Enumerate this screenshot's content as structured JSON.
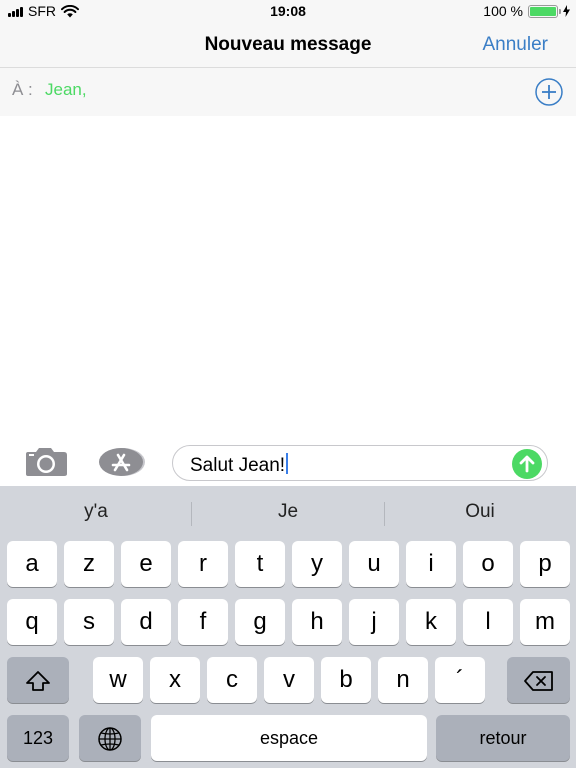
{
  "status_bar": {
    "carrier": "SFR",
    "time": "19:08",
    "battery": "100 %",
    "battery_level": 1.0
  },
  "nav": {
    "title": "Nouveau message",
    "cancel_label": "Annuler"
  },
  "recipients": {
    "label": "À :",
    "value": "Jean,"
  },
  "compose": {
    "message_text": "Salut Jean!"
  },
  "keyboard": {
    "suggestions": [
      "y'a",
      "Je",
      "Oui"
    ],
    "row1": [
      "a",
      "z",
      "e",
      "r",
      "t",
      "y",
      "u",
      "i",
      "o",
      "p"
    ],
    "row2": [
      "q",
      "s",
      "d",
      "f",
      "g",
      "h",
      "j",
      "k",
      "l",
      "m"
    ],
    "row3": [
      "w",
      "x",
      "c",
      "v",
      "b",
      "n",
      "´"
    ],
    "numbers_label": "123",
    "space_label": "espace",
    "return_label": "retour"
  },
  "colors": {
    "accent_blue": "#3a7ec6",
    "recipient_green": "#4cd964",
    "send_green": "#4cd964",
    "keyboard_bg": "#d2d5db"
  }
}
